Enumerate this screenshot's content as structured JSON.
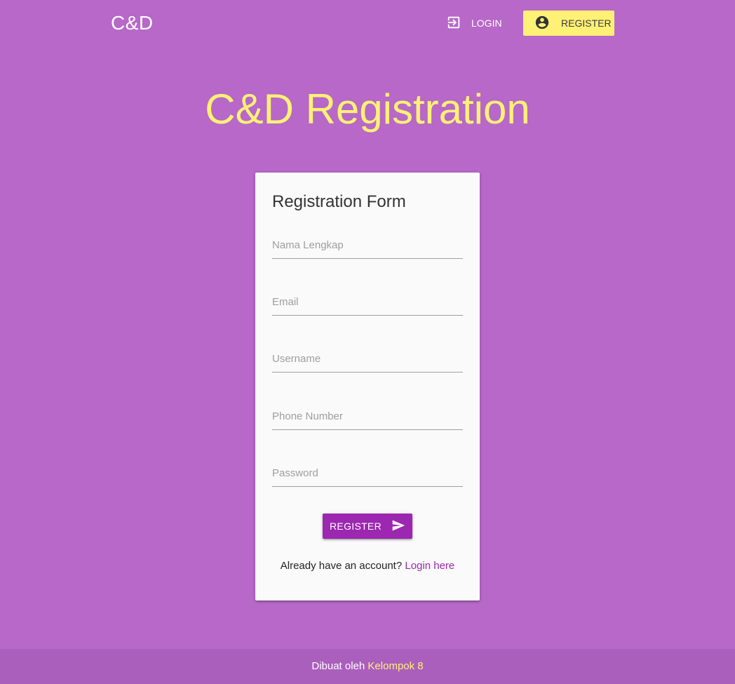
{
  "navbar": {
    "brand": "C&D",
    "login_label": "LOGIN",
    "register_label": "REGISTER"
  },
  "hero": {
    "title": "C&D Registration"
  },
  "form": {
    "title": "Registration Form",
    "fields": {
      "full_name": {
        "placeholder": "Nama Lengkap",
        "value": ""
      },
      "email": {
        "placeholder": "Email",
        "value": ""
      },
      "username": {
        "placeholder": "Username",
        "value": ""
      },
      "phone": {
        "placeholder": "Phone Number",
        "value": ""
      },
      "password": {
        "placeholder": "Password",
        "value": ""
      }
    },
    "submit_label": "REGISTER",
    "account_prompt": "Already have an account?",
    "login_link": "Login here"
  },
  "footer": {
    "prefix": "Dibuat oleh",
    "team": "Kelompok 8"
  },
  "icons": {
    "login": "login-icon",
    "account": "account-circle-icon",
    "send": "send-icon"
  },
  "colors": {
    "background": "#b768c8",
    "accent_yellow": "#fff176",
    "primary_purple": "#9c27b0",
    "card": "#fafafa",
    "footer": "#ab5fbd"
  }
}
